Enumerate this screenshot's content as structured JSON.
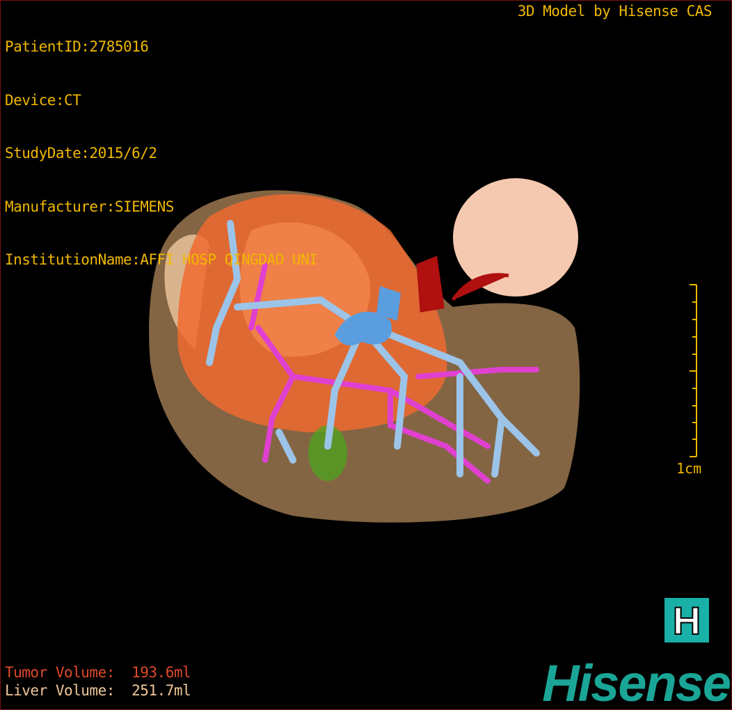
{
  "patient_info": {
    "patient_id": "PatientID:2785016",
    "device": "Device:CT",
    "study_date": "StudyDate:2015/6/2",
    "manufacturer": "Manufacturer:SIEMENS",
    "institution": "InstitutionName:AFFI HOSP QINGDAO UNI"
  },
  "credit": "3D Model by Hisense CAS",
  "scale_bar": {
    "label": "1cm",
    "color": "#f0b800"
  },
  "volumes": {
    "tumor": "Tumor Volume:  193.6ml",
    "liver": "Liver Volume:  251.7ml"
  },
  "logo": {
    "icon_letter": "H",
    "brand": "Hisense",
    "color": "#1aa597"
  },
  "model_colors": {
    "liver": "#a8805a",
    "tumor": "#f06a30",
    "portal_vein": "#9cc4e8",
    "hepatic_vein": "#e040d0",
    "artery": "#b01010",
    "gallbladder": "#50a020",
    "kidney": "#f5c8b0"
  }
}
